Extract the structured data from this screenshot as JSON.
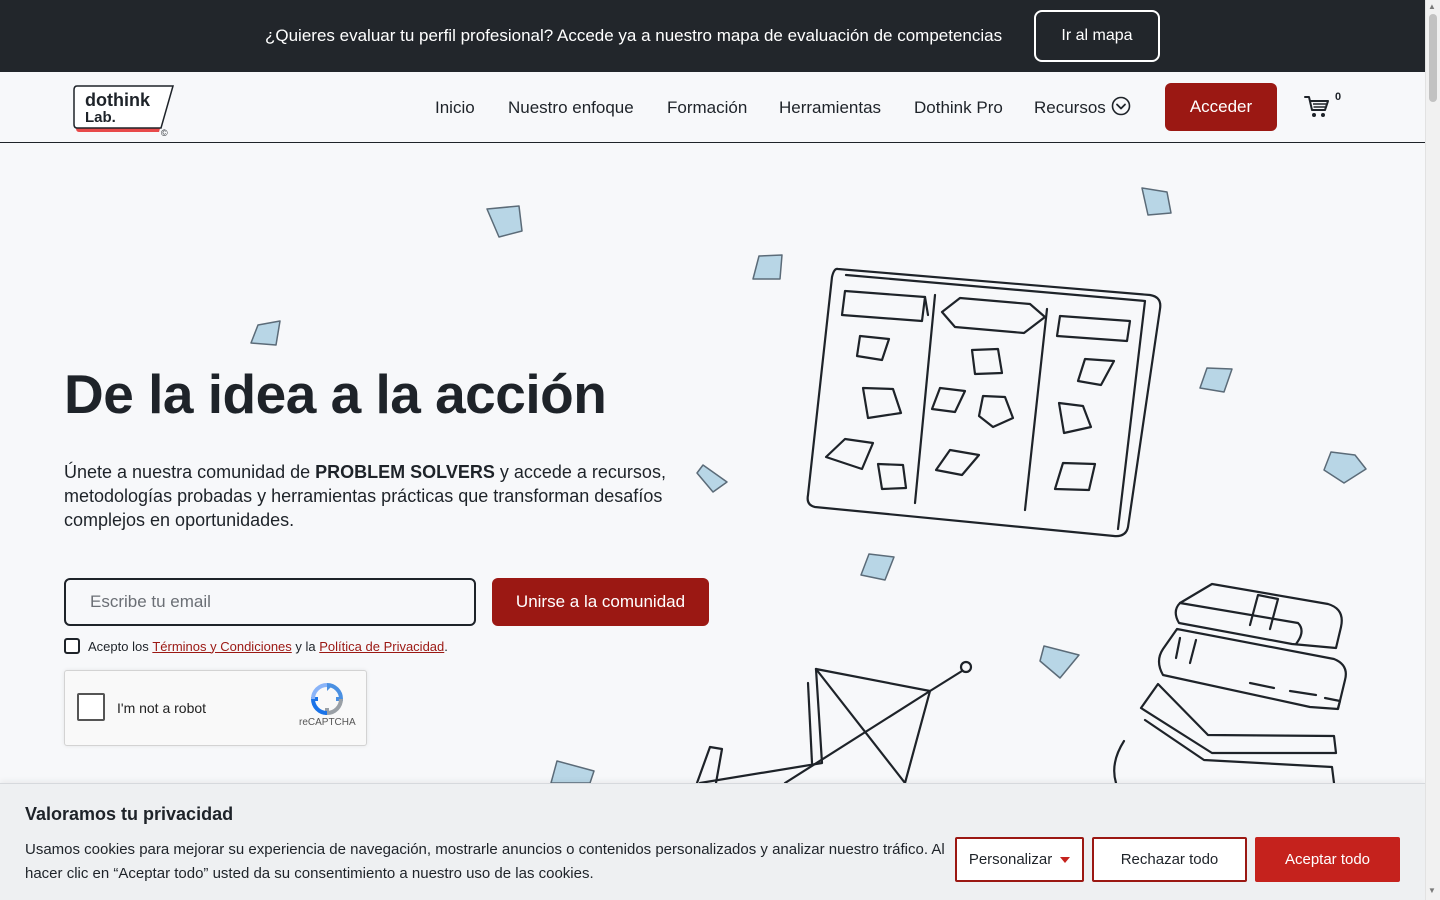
{
  "promo": {
    "text": "¿Quieres evaluar tu perfil profesional? Accede ya a nuestro mapa de evaluación de competencias",
    "button": "Ir al mapa"
  },
  "header": {
    "logo_line1": "dothink",
    "logo_line2": "Lab.",
    "logo_mark": "©",
    "nav": [
      "Inicio",
      "Nuestro enfoque",
      "Formación",
      "Herramientas",
      "Dothink Pro",
      "Recursos"
    ],
    "login_button": "Acceder",
    "cart_count": "0"
  },
  "hero": {
    "title": "De la idea a la acción",
    "subtitle_before": "Únete a nuestra comunidad de ",
    "subtitle_bold": "PROBLEM SOLVERS",
    "subtitle_after": " y accede a recursos, metodologías probadas y herramientas prácticas que transforman desafíos complejos en oportunidades.",
    "email_placeholder": "Escribe tu email",
    "join_button": "Unirse a la comunidad",
    "terms_prefix": "Acepto los ",
    "terms_link": "Términos y Condiciones",
    "terms_middle": " y la ",
    "privacy_link": "Política de Privacidad",
    "terms_suffix": "."
  },
  "recaptcha": {
    "label": "I'm not a robot",
    "brand": "reCAPTCHA"
  },
  "cookie": {
    "title": "Valoramos tu privacidad",
    "text": "Usamos cookies para mejorar su experiencia de navegación, mostrarle anuncios o contenidos personalizados y analizar nuestro tráfico. Al hacer clic en “Aceptar todo” usted da su consentimiento a nuestro uso de las cookies.",
    "customize": "Personalizar",
    "reject": "Rechazar todo",
    "accept": "Aceptar todo"
  },
  "colors": {
    "brand_red": "#9b1813",
    "accept_red": "#c5221d",
    "dark": "#22262b",
    "sticky_note": "#b8d6e6"
  }
}
